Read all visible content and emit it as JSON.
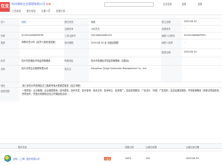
{
  "header": {
    "logo": "仅支",
    "company": "杭州青梓企业管理有限公司",
    "company_tag": "存续",
    "search_placeholder": "",
    "tabs": [
      "工商信息",
      "股东信息",
      "主要人员",
      "变更记录"
    ],
    "right_items": [
      "企业信息",
      "应用",
      "全部"
    ]
  },
  "rows": [
    {
      "cells": [
        {
          "k": "label1",
          "text": "法人"
        },
        {
          "k": "v1",
          "text": "钱晓",
          "blue": true
        },
        {
          "k": "label2",
          "text": "登记状态"
        },
        {
          "k": "v2",
          "text": "存续"
        },
        {
          "k": "label3",
          "text": "成立日期"
        },
        {
          "k": "v3",
          "text": "2025-06-30"
        }
      ]
    },
    {
      "cells": [
        {
          "k": "label1",
          "text": ""
        },
        {
          "k": "v1",
          "text": ""
        },
        {
          "k": "label2",
          "text": "注册资本"
        },
        {
          "k": "v2",
          "text": "100万元"
        },
        {
          "k": "label3",
          "text": "实缴资本"
        },
        {
          "k": "v3",
          "text": "-"
        }
      ]
    },
    {
      "cells": [
        {
          "k": "label1",
          "text": "代码"
        },
        {
          "k": "v1",
          "text": "9133010MAEPDF08-"
        },
        {
          "k": "label2",
          "text": "工商注册号"
        },
        {
          "k": "v2",
          "text": "330108000085125"
        },
        {
          "k": "label3",
          "text": "纳税人识别号"
        },
        {
          "k": "v3",
          "text": "91330108MAEPDF0"
        }
      ]
    },
    {
      "cells": [
        {
          "k": "label1",
          "text": "类型"
        },
        {
          "k": "v1",
          "text": "有限责任公司（自然人投资或控股）",
          "wrap": true
        },
        {
          "k": "label2",
          "text": "营业期限"
        },
        {
          "k": "v2",
          "text": "2025-06-30 至 无固定期限"
        },
        {
          "k": "label3",
          "text": "纳税人资质"
        },
        {
          "k": "v3",
          "text": "-"
        }
      ]
    },
    {
      "cells": [
        {
          "k": "label1",
          "text": ""
        },
        {
          "k": "v1",
          "text": ""
        },
        {
          "k": "label2",
          "text": ""
        },
        {
          "k": "v2",
          "text": ""
        },
        {
          "k": "label3",
          "text": "核准日期"
        },
        {
          "k": "v3",
          "text": "2025-06-30"
        }
      ]
    },
    {
      "cells": [
        {
          "k": "label1",
          "text": "机关"
        },
        {
          "k": "v1",
          "text": "杭州市西湖区市场监督管理局"
        },
        {
          "k": "label2",
          "text": "所属地区"
        },
        {
          "k": "v2",
          "text": "杭州市西湖区市场监督管理局（高新区）"
        },
        {
          "k": "label3",
          "text": ""
        },
        {
          "k": "v3",
          "text": ""
        }
      ]
    },
    {
      "cells": [
        {
          "k": "label1",
          "text": "名称"
        },
        {
          "k": "v1",
          "text": "杭州青梓企业管理有限公司",
          "wrap": true
        },
        {
          "k": "label2",
          "text": "英文名"
        },
        {
          "k": "v2",
          "text": "Hangzhou Qingzi Enterprise Management Co., Ltd."
        },
        {
          "k": "label3",
          "text": ""
        },
        {
          "k": "v3",
          "text": ""
        }
      ]
    }
  ],
  "address": {
    "label": "地址",
    "value": "浙江省杭州市西湖区文三路某号某大厦某层某室（自主申报）"
  },
  "scope": {
    "label": "经营范围",
    "value": "一般项目：企业管理；企业管理咨询；技术服务、技术开发、技术咨询、技术交流、技术转让、技术推广；信息咨询服务；广告设计、代理；广告发布；会议及展览服务；市场营销策划（除依法须经批准的项目外，凭营业执照依法自主开展经营活动）。"
  },
  "shareholder_section": {
    "headers": [
      "股东信息",
      "",
      "持股比例",
      "认缴出资额",
      "认缴出资日期"
    ]
  },
  "shareholders": [
    {
      "name": "钱晓",
      "sub": "钱晓（上海）股份有限公司",
      "tag": "大股东",
      "ratio": "100%",
      "amount": "100",
      "date": "2025-06-30"
    }
  ]
}
